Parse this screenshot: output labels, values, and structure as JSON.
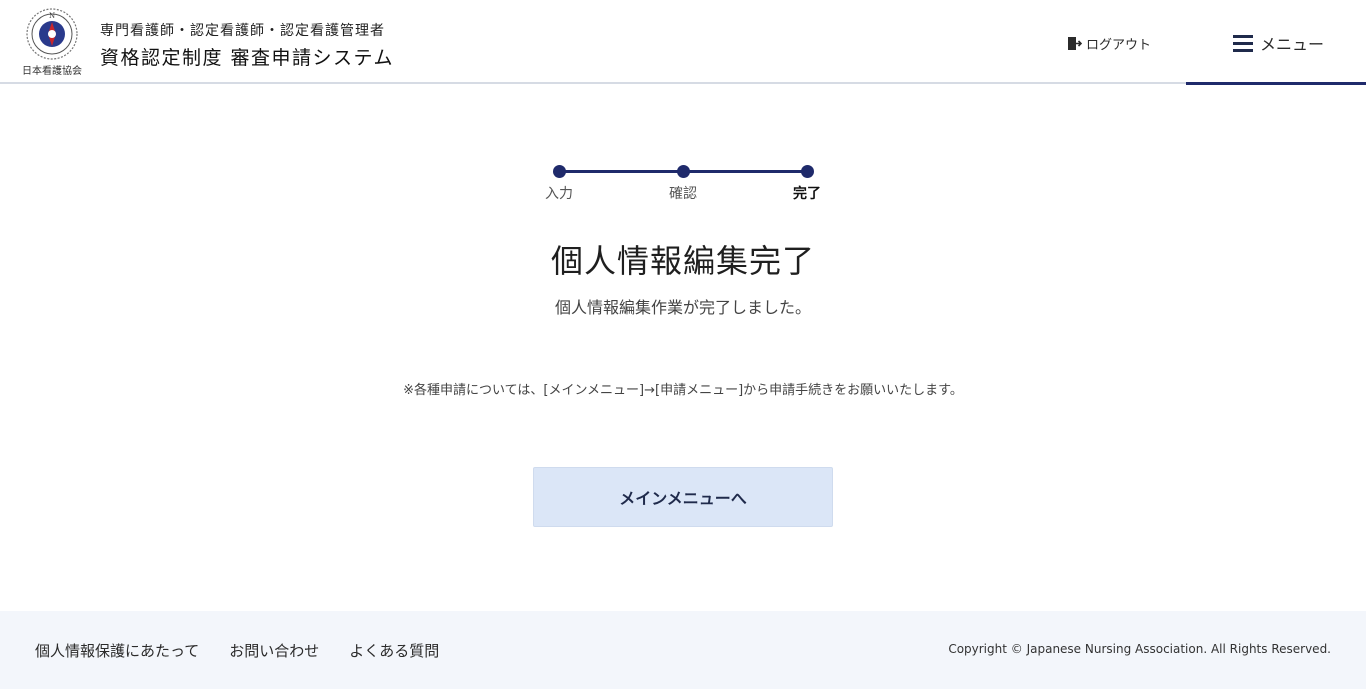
{
  "header": {
    "org_caption": "日本看護協会",
    "title_sub": "専門看護師・認定看護師・認定看護管理者",
    "title_main": "資格認定制度 審査申請システム",
    "logout_label": "ログアウト",
    "menu_label": "メニュー"
  },
  "stepper": {
    "steps": [
      {
        "label": "入力",
        "state": "done"
      },
      {
        "label": "確認",
        "state": "done"
      },
      {
        "label": "完了",
        "state": "current"
      }
    ]
  },
  "main": {
    "title": "個人情報編集完了",
    "message": "個人情報編集作業が完了しました。",
    "note": "※各種申請については、[メインメニュー]→[申請メニュー]から申請手続きをお願いいたします。",
    "button_label": "メインメニューへ"
  },
  "footer": {
    "links": [
      "個人情報保護にあたって",
      "お問い合わせ",
      "よくある質問"
    ],
    "copyright": "Copyright © Japanese Nursing Association. All Rights Reserved."
  },
  "colors": {
    "accent": "#1f2a6b",
    "button_bg": "#dbe6f7",
    "footer_bg": "#f3f6fb"
  }
}
